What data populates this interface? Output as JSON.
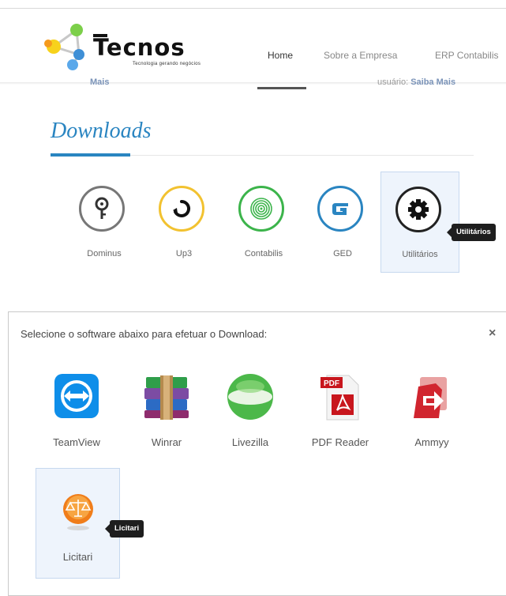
{
  "header": {
    "logo_text": "Tecnos",
    "logo_subtext": "Tecnologia gerando negócios",
    "nav": [
      {
        "label": "Home",
        "active": true
      },
      {
        "label": "Sobre a Empresa",
        "active": false
      },
      {
        "label": "ERP Contabilis",
        "active": false
      }
    ],
    "partial_left": "Mais",
    "partial_right_prefix": "usuário:",
    "partial_right_link": "Saiba Mais"
  },
  "downloads": {
    "title": "Downloads",
    "accent_color": "#2a85c1",
    "products": [
      {
        "label": "Dominus",
        "icon": "key-icon",
        "color": "#777777"
      },
      {
        "label": "Up3",
        "icon": "refresh-icon",
        "color": "#f2c230"
      },
      {
        "label": "Contabilis",
        "icon": "target-icon",
        "color": "#3cb44b"
      },
      {
        "label": "GED",
        "icon": "g-icon",
        "color": "#2a85c1"
      },
      {
        "label": "Utilitários",
        "icon": "gear-icon",
        "color": "#222222",
        "selected": true
      }
    ],
    "tooltip": "Utilitários"
  },
  "modal": {
    "title": "Selecione o software abaixo para efetuar o Download:",
    "close": "×",
    "software": [
      {
        "label": "TeamView",
        "icon": "teamviewer-icon"
      },
      {
        "label": "Winrar",
        "icon": "winrar-icon"
      },
      {
        "label": "Livezilla",
        "icon": "livezilla-icon"
      },
      {
        "label": "PDF Reader",
        "icon": "pdf-reader-icon",
        "badge": "PDF"
      },
      {
        "label": "Ammyy",
        "icon": "ammyy-icon"
      },
      {
        "label": "Licitari",
        "icon": "licitari-icon",
        "selected": true
      }
    ],
    "tooltip": "Licitari"
  }
}
